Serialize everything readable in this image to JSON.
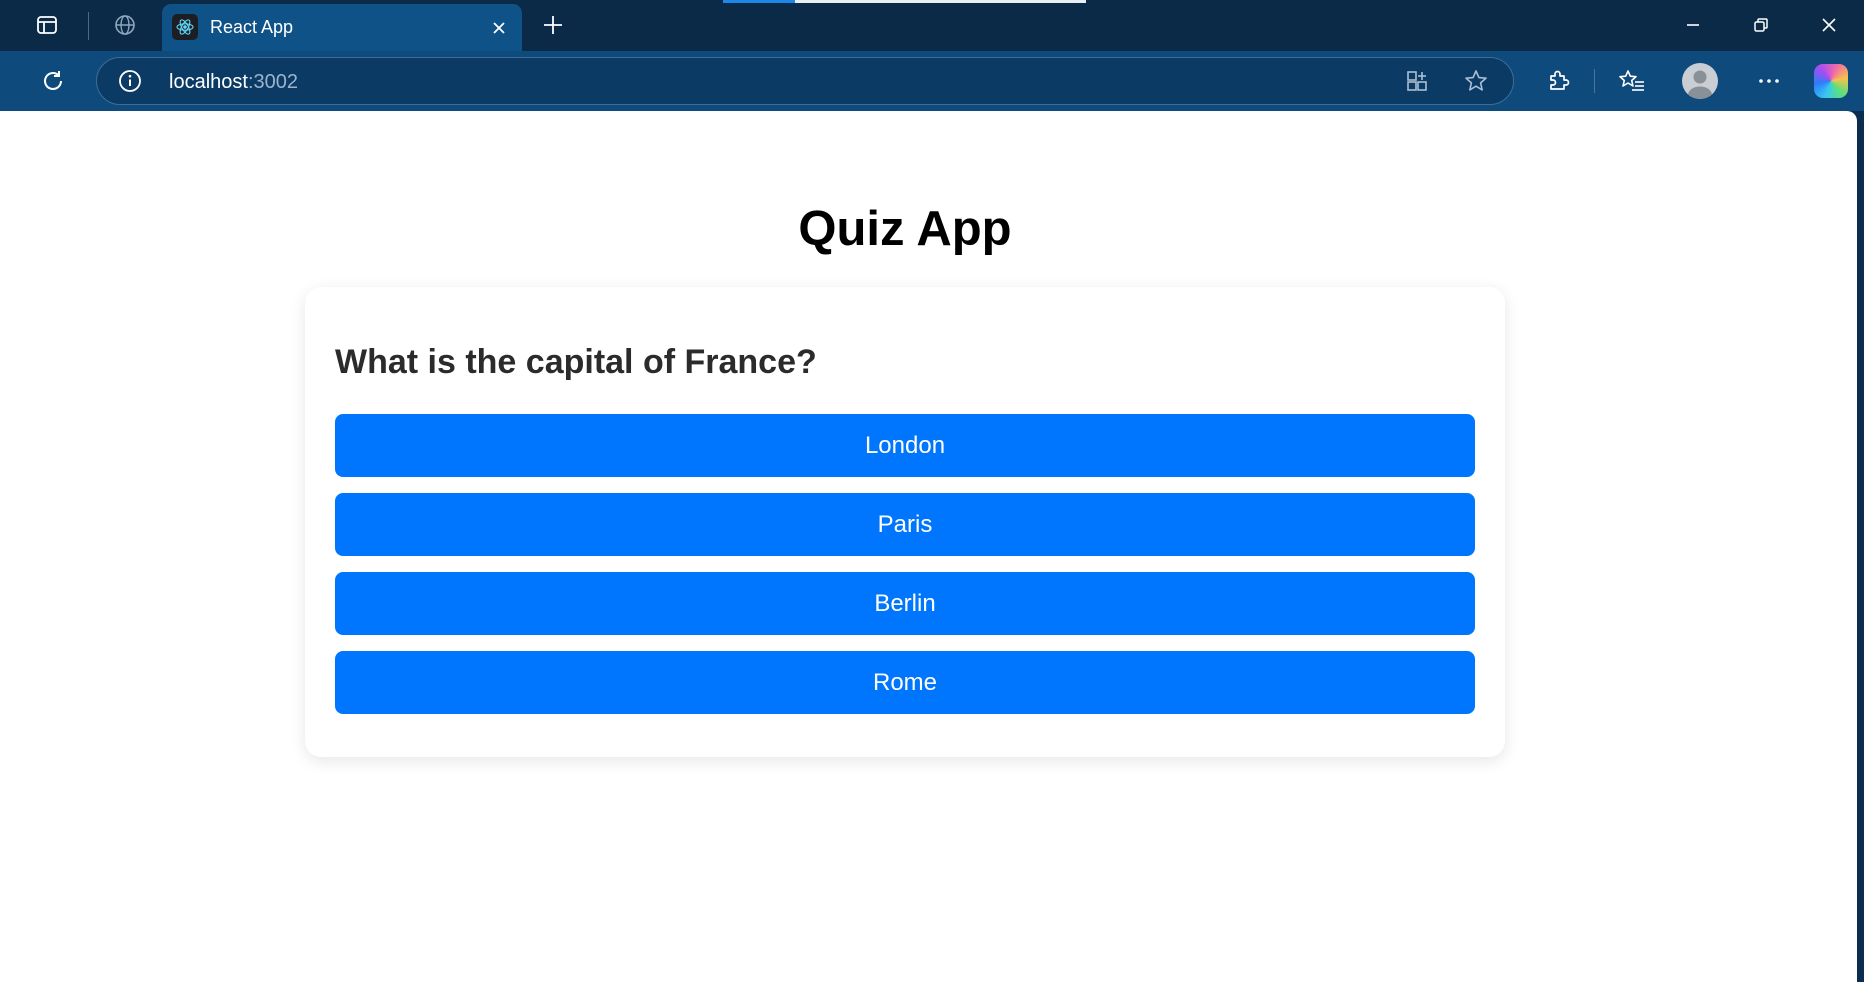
{
  "browser": {
    "tab": {
      "title": "React App"
    },
    "address": {
      "host": "localhost",
      "port": ":3002"
    },
    "icons": {
      "tab_actions": "tab-actions-icon",
      "globe": "globe-icon",
      "favicon": "react-logo-icon",
      "close": "close-icon",
      "new_tab": "plus-icon",
      "refresh": "refresh-icon",
      "info": "info-icon",
      "app_grid": "app-available-icon",
      "favorite": "star-icon",
      "extensions": "puzzle-icon",
      "favorites": "favorites-icon",
      "profile": "profile-avatar",
      "more": "more-icon",
      "copilot": "copilot-icon"
    },
    "colors": {
      "frame": "#0b2a47",
      "toolbar": "#0f4a7c",
      "active_tab": "#0f5287"
    }
  },
  "page": {
    "title": "Quiz App",
    "question": "What is the capital of France?",
    "answers": [
      "London",
      "Paris",
      "Berlin",
      "Rome"
    ],
    "colors": {
      "answer_button": "#0076fe",
      "question_text": "#2b2b2b"
    }
  }
}
